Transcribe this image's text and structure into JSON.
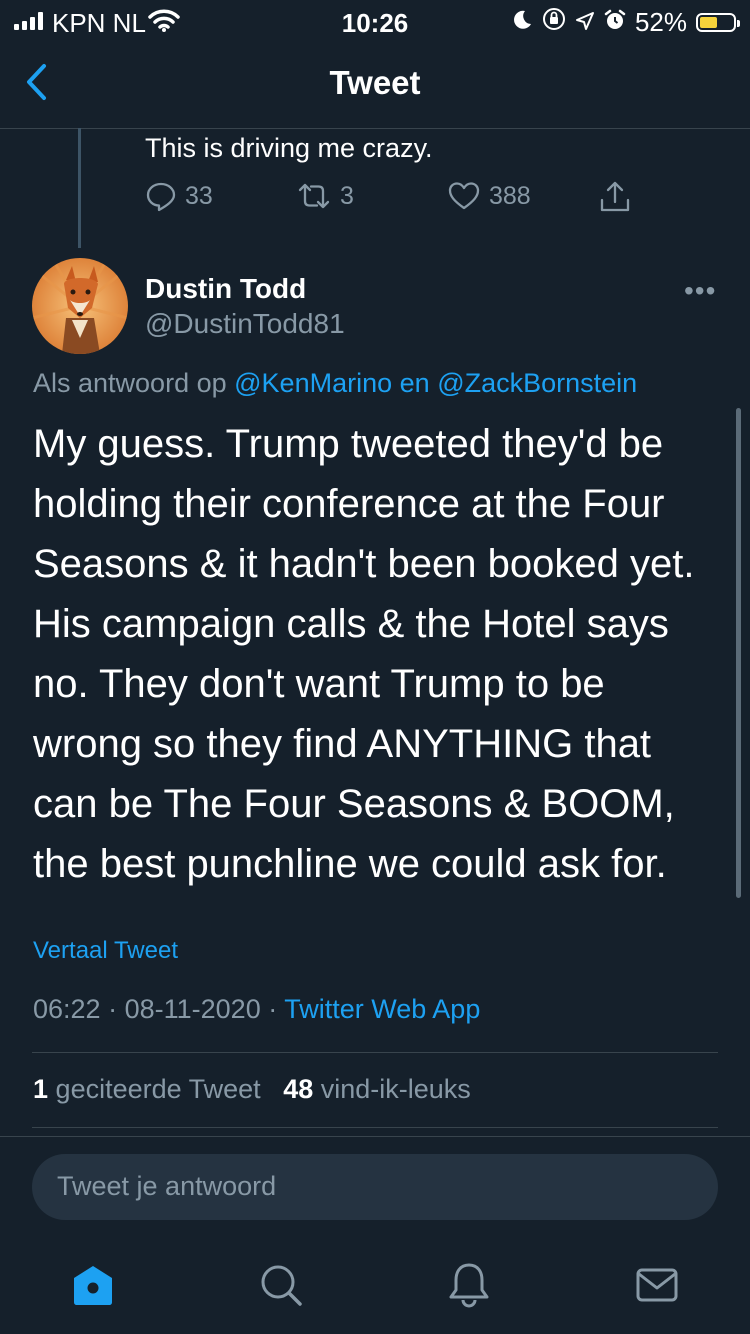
{
  "status_bar": {
    "carrier": "KPN NL",
    "time": "10:26",
    "battery_percent": "52%",
    "battery_level": 0.52,
    "icons": [
      "signal-icon",
      "wifi-icon",
      "moon-icon",
      "orientation-lock-icon",
      "location-icon",
      "alarm-icon",
      "battery-icon"
    ]
  },
  "nav": {
    "title": "Tweet",
    "back_icon": "chevron-left-icon"
  },
  "previous_tweet": {
    "text": "This is driving me crazy.",
    "replies": "33",
    "retweets": "3",
    "likes": "388"
  },
  "tweet": {
    "author_name": "Dustin Todd",
    "author_handle": "@DustinTodd81",
    "more_label": "•••",
    "reply_prefix": "Als antwoord op",
    "reply_user1": "@KenMarino",
    "reply_joiner": "en",
    "reply_user2": "@ZackBornstein",
    "lines": [
      "My guess. Trump tweeted they'd be",
      "holding their conference at the Four",
      "Seasons & it hadn't been booked yet.",
      "His campaign calls & the Hotel says",
      "no. They don't want Trump to be",
      "wrong so they find ANYTHING that",
      "can be The Four Seasons & BOOM,",
      "the best punchline we could ask for."
    ],
    "translate_label": "Vertaal Tweet",
    "time": "06:22",
    "date": "08-11-2020",
    "separator": "·",
    "source": "Twitter Web App",
    "quote_count": "1",
    "quote_label": "geciteerde Tweet",
    "like_count": "48",
    "like_label": "vind-ik-leuks"
  },
  "reply_box": {
    "placeholder": "Tweet je antwoord"
  },
  "tabs": [
    "home-icon",
    "search-icon",
    "notifications-icon",
    "messages-icon"
  ],
  "colors": {
    "background": "#15202b",
    "accent": "#1da1f2",
    "secondary_text": "#8899a6",
    "divider": "#38444d"
  }
}
